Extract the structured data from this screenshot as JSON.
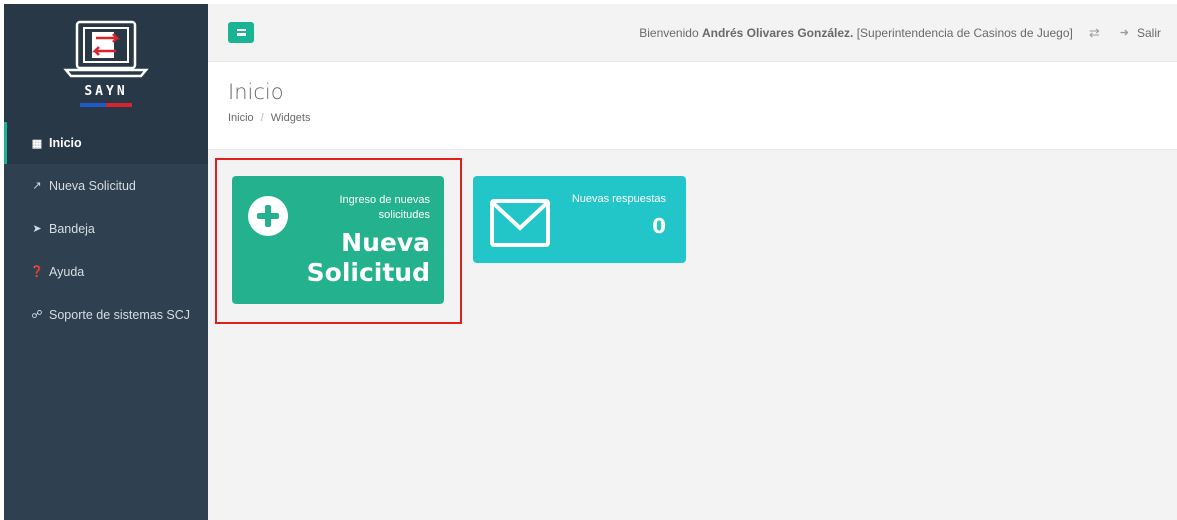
{
  "brand": {
    "name": "SAYN",
    "logo_icon": "laptop-swap-logo"
  },
  "sidebar": {
    "items": [
      {
        "label": "Inicio",
        "icon": "dashboard-icon",
        "active": true
      },
      {
        "label": "Nueva Solicitud",
        "icon": "external-link-icon",
        "active": false
      },
      {
        "label": "Bandeja",
        "icon": "send-icon",
        "active": false
      },
      {
        "label": "Ayuda",
        "icon": "help-icon",
        "active": false
      },
      {
        "label": "Soporte de sistemas SCJ",
        "icon": "headset-icon",
        "active": false
      }
    ]
  },
  "topbar": {
    "menu_icon": "hamburger-icon",
    "welcome_prefix": "Bienvenido",
    "user_name": "Andrés Olivares González.",
    "institution": "[Superintendencia de Casinos de Juego]",
    "swap_icon": "exchange-icon",
    "logout_label": "Salir"
  },
  "heading": {
    "title": "Inicio",
    "breadcrumb": [
      "Inicio",
      "Widgets"
    ],
    "breadcrumb_sep": "/"
  },
  "widgets": [
    {
      "small_text": "Ingreso de nuevas solicitudes",
      "big_text_1": "Nueva",
      "big_text_2": "Solicitud",
      "icon": "plus-circle-icon",
      "color": "#23b28d"
    },
    {
      "small_text": "Nuevas respuestas",
      "count": "0",
      "icon": "envelope-icon",
      "color": "#23c6c8"
    }
  ],
  "colors": {
    "sidebar": "#2f4050",
    "accent": "#1ab394",
    "highlight_border": "#e02020"
  }
}
